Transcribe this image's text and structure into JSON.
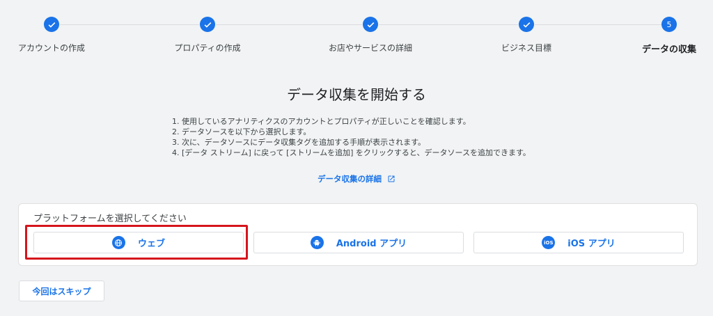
{
  "stepper": {
    "steps": [
      {
        "label": "アカウントの作成",
        "state": "done"
      },
      {
        "label": "プロパティの作成",
        "state": "done"
      },
      {
        "label": "お店やサービスの詳細",
        "state": "done"
      },
      {
        "label": "ビジネス目標",
        "state": "done"
      },
      {
        "label": "データの収集",
        "state": "active",
        "number": "5"
      }
    ]
  },
  "main": {
    "title": "データ収集を開始する",
    "instructions": [
      "1. 使用しているアナリティクスのアカウントとプロパティが正しいことを確認します。",
      "2. データソースを以下から選択します。",
      "3. 次に、データソースにデータ収集タグを追加する手順が表示されます。",
      "4. [データ ストリーム] に戻って [ストリームを追加] をクリックすると、データソースを追加できます。"
    ],
    "details_link": "データ収集の詳細"
  },
  "platform": {
    "title": "プラットフォームを選択してください",
    "options": [
      {
        "label": "ウェブ",
        "icon": "globe-icon"
      },
      {
        "label": "Android アプリ",
        "icon": "android-icon"
      },
      {
        "label": "iOS アプリ",
        "icon": "ios-icon",
        "icon_text": "iOS"
      }
    ]
  },
  "footer": {
    "skip_label": "今回はスキップ"
  },
  "colors": {
    "accent": "#1a73e8",
    "highlight": "#d6141c",
    "background": "#f1f3f4"
  }
}
